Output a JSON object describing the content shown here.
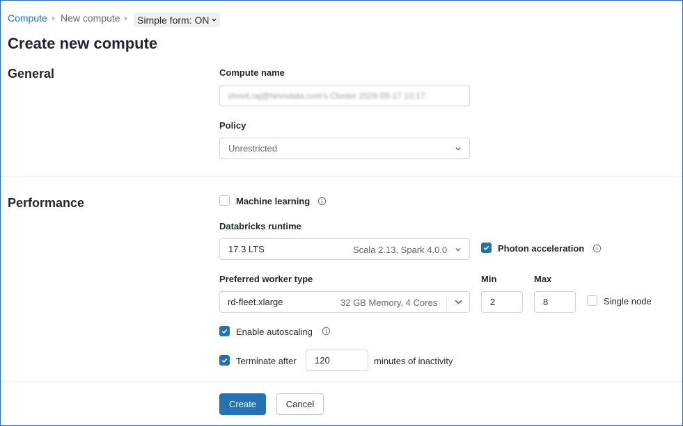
{
  "breadcrumb": {
    "root": "Compute",
    "sep": "›",
    "current": "New compute",
    "simple_form": "Simple form: ON"
  },
  "page": {
    "title": "Create new compute"
  },
  "general": {
    "title": "General",
    "compute_name_label": "Compute name",
    "compute_name_value": "shovit.raj@hevodata.com's Cluster 2026-09-17 10:17:",
    "policy_label": "Policy",
    "policy_value": "Unrestricted"
  },
  "performance": {
    "title": "Performance",
    "machine_learning_label": "Machine learning",
    "machine_learning_checked": false,
    "runtime_label": "Databricks runtime",
    "runtime_value": "17.3 LTS",
    "runtime_detail": "Scala 2.13, Spark 4.0.0",
    "photon_label": "Photon acceleration",
    "photon_checked": true,
    "worker_type_label": "Preferred worker type",
    "worker_type_value": "rd-fleet.xlarge",
    "worker_type_detail": "32 GB Memory, 4 Cores",
    "min_label": "Min",
    "min_value": "2",
    "max_label": "Max",
    "max_value": "8",
    "single_node_label": "Single node",
    "single_node_checked": false,
    "autoscaling_label": "Enable autoscaling",
    "autoscaling_checked": true,
    "terminate_label": "Terminate after",
    "terminate_checked": true,
    "terminate_value": "120",
    "terminate_suffix": "minutes of inactivity"
  },
  "footer": {
    "create_label": "Create",
    "cancel_label": "Cancel"
  },
  "colors": {
    "accent": "#2272b4",
    "border": "#cfd4d9",
    "text": "#1f272d",
    "muted": "#5f6770"
  }
}
